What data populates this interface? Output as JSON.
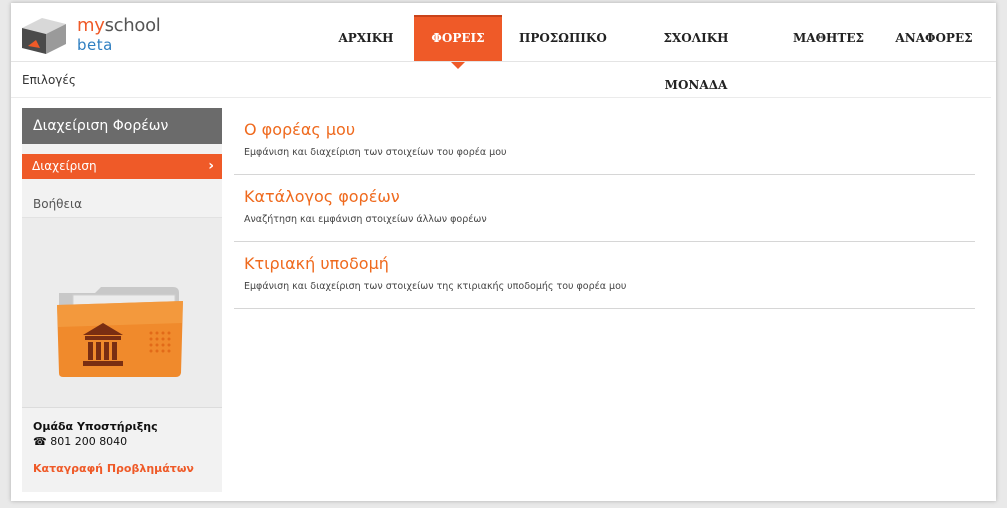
{
  "brand": {
    "my": "my",
    "school": "school",
    "beta": "beta"
  },
  "nav": [
    {
      "label": "ΑΡΧΙΚΗ",
      "active": false
    },
    {
      "label": "ΦΟΡΕΙΣ",
      "active": true
    },
    {
      "label": "ΠΡΟΣΩΠΙΚΟ",
      "active": false
    },
    {
      "label": "ΣΧΟΛΙΚΗ ΜΟΝΑΔΑ",
      "active": false
    },
    {
      "label": "ΜΑΘΗΤΕΣ",
      "active": false
    },
    {
      "label": "ΑΝΑΦΟΡΕΣ",
      "active": false
    }
  ],
  "breadcrumb": "Επιλογές",
  "sidebar": {
    "title": "Διαχείριση Φορέων",
    "items": [
      {
        "label": "Διαχείριση",
        "active": true
      },
      {
        "label": "Βοήθεια",
        "active": false
      }
    ],
    "support": {
      "team": "Ομάδα Υποστήριξης",
      "phone": "801 200 8040",
      "report": "Καταγραφή Προβλημάτων"
    }
  },
  "main": {
    "entries": [
      {
        "title": "Ο φορέας μου",
        "desc": "Εμφάνιση και διαχείριση των στοιχείων του φορέα μου"
      },
      {
        "title": "Κατάλογος φορέων",
        "desc": "Αναζήτηση και εμφάνιση στοιχείων άλλων φορέων"
      },
      {
        "title": "Κτιριακή υποδομή",
        "desc": "Εμφάνιση και διαχείριση των στοιχείων της κτιριακής υποδομής του φορέα μου"
      }
    ]
  },
  "colors": {
    "accent": "#ef5a28",
    "sidebar_title": "#6b6b6b",
    "link": "#ef6a1e"
  }
}
